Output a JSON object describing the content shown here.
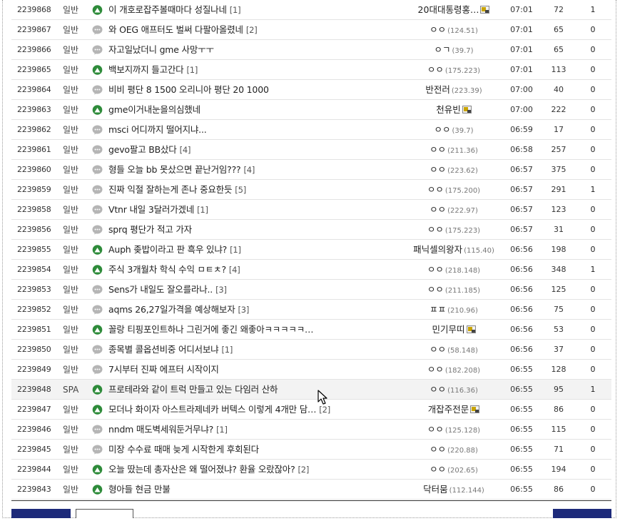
{
  "rows": [
    {
      "num": "2239868",
      "sub": "일반",
      "icon": "image-icon",
      "title": "이 개호로잡주볼때마다 성질나네",
      "comments": "[1]",
      "writer": "20대대통령홍…",
      "ip": "",
      "badge": true,
      "date": "07:01",
      "views": "72",
      "rec": "1"
    },
    {
      "num": "2239867",
      "sub": "일반",
      "icon": "chat-icon",
      "title": "와 OEG 애프터도 벌써 다팔아올렸네",
      "comments": "[2]",
      "writer": "ㅇㅇ",
      "ip": "(124.51)",
      "badge": false,
      "date": "07:01",
      "views": "65",
      "rec": "0"
    },
    {
      "num": "2239866",
      "sub": "일반",
      "icon": "chat-icon",
      "title": "자고일났더니 gme 사망ㅜㅜ",
      "comments": "",
      "writer": "ㅇㄱ",
      "ip": "(39.7)",
      "badge": false,
      "date": "07:01",
      "views": "65",
      "rec": "0"
    },
    {
      "num": "2239865",
      "sub": "일반",
      "icon": "image-icon",
      "title": "백보지까지 들고간다",
      "comments": "[1]",
      "writer": "ㅇㅇ",
      "ip": "(175.223)",
      "badge": false,
      "date": "07:01",
      "views": "113",
      "rec": "0"
    },
    {
      "num": "2239864",
      "sub": "일반",
      "icon": "chat-icon",
      "title": "비비 평단 8 1500 오리니아 평단 20 1000",
      "comments": "",
      "writer": "반전러",
      "ip": "(223.39)",
      "badge": false,
      "date": "07:00",
      "views": "40",
      "rec": "0"
    },
    {
      "num": "2239863",
      "sub": "일반",
      "icon": "image-icon",
      "title": "gme이거내눈을의심했네",
      "comments": "",
      "writer": "천유빈",
      "ip": "",
      "badge": true,
      "date": "07:00",
      "views": "222",
      "rec": "0"
    },
    {
      "num": "2239862",
      "sub": "일반",
      "icon": "chat-icon",
      "title": "msci 어디까지 떨어지냐...",
      "comments": "",
      "writer": "ㅇㅇ",
      "ip": "(39.7)",
      "badge": false,
      "date": "06:59",
      "views": "17",
      "rec": "0"
    },
    {
      "num": "2239861",
      "sub": "일반",
      "icon": "chat-icon",
      "title": "gevo팔고 BB샀다",
      "comments": "[4]",
      "writer": "ㅇㅇ",
      "ip": "(211.36)",
      "badge": false,
      "date": "06:58",
      "views": "257",
      "rec": "0"
    },
    {
      "num": "2239860",
      "sub": "일반",
      "icon": "chat-icon",
      "title": "형들 오늘 bb 못샀으면 끝난거임???",
      "comments": "[4]",
      "writer": "ㅇㅇ",
      "ip": "(223.62)",
      "badge": false,
      "date": "06:57",
      "views": "375",
      "rec": "0"
    },
    {
      "num": "2239859",
      "sub": "일반",
      "icon": "chat-icon",
      "title": "진짜 익절 잘하는게 존나 중요한듯",
      "comments": "[5]",
      "writer": "ㅇㅇ",
      "ip": "(175.200)",
      "badge": false,
      "date": "06:57",
      "views": "291",
      "rec": "1"
    },
    {
      "num": "2239858",
      "sub": "일반",
      "icon": "chat-icon",
      "title": "Vtnr 내일 3달러가겠네",
      "comments": "[1]",
      "writer": "ㅇㅇ",
      "ip": "(222.97)",
      "badge": false,
      "date": "06:57",
      "views": "123",
      "rec": "0"
    },
    {
      "num": "2239856",
      "sub": "일반",
      "icon": "chat-icon",
      "title": "sprq 평단가 적고 가자",
      "comments": "",
      "writer": "ㅇㅇ",
      "ip": "(175.223)",
      "badge": false,
      "date": "06:57",
      "views": "31",
      "rec": "0"
    },
    {
      "num": "2239855",
      "sub": "일반",
      "icon": "image-icon",
      "title": "Auph 좆밥이라고 판 흑우 있냐?",
      "comments": "[1]",
      "writer": "패닉셀의왕자",
      "ip": "(115.40)",
      "badge": false,
      "date": "06:56",
      "views": "198",
      "rec": "0"
    },
    {
      "num": "2239854",
      "sub": "일반",
      "icon": "image-icon",
      "title": "주식 3개월차 학식 수익 ㅁㅌㅊ?",
      "comments": "[4]",
      "writer": "ㅇㅇ",
      "ip": "(218.148)",
      "badge": false,
      "date": "06:56",
      "views": "348",
      "rec": "1"
    },
    {
      "num": "2239853",
      "sub": "일반",
      "icon": "chat-icon",
      "title": "Sens가 내일도 잘오를라나..",
      "comments": "[3]",
      "writer": "ㅇㅇ",
      "ip": "(211.185)",
      "badge": false,
      "date": "06:56",
      "views": "125",
      "rec": "0"
    },
    {
      "num": "2239852",
      "sub": "일반",
      "icon": "chat-icon",
      "title": "aqms 26,27일가격을 예상해보자",
      "comments": "[3]",
      "writer": "ㅍㅍ",
      "ip": "(210.96)",
      "badge": false,
      "date": "06:56",
      "views": "75",
      "rec": "0"
    },
    {
      "num": "2239851",
      "sub": "일반",
      "icon": "image-icon",
      "title": "꼴랑 티핑포인트하나 그린거에 좋긴 왜좋아ㅋㅋㅋㅋㅋ…",
      "comments": "",
      "writer": "민기무띠",
      "ip": "",
      "badge": true,
      "date": "06:56",
      "views": "53",
      "rec": "0"
    },
    {
      "num": "2239850",
      "sub": "일반",
      "icon": "chat-icon",
      "title": "종목별 콜옵션비중 어디서보냐",
      "comments": "[1]",
      "writer": "ㅇㅇ",
      "ip": "(58.148)",
      "badge": false,
      "date": "06:56",
      "views": "37",
      "rec": "0"
    },
    {
      "num": "2239849",
      "sub": "일반",
      "icon": "chat-icon",
      "title": "7시부터 진짜 에프터 시작이지",
      "comments": "",
      "writer": "ㅇㅇ",
      "ip": "(182.208)",
      "badge": false,
      "date": "06:55",
      "views": "128",
      "rec": "0"
    },
    {
      "num": "2239848",
      "sub": "SPA",
      "icon": "image-icon",
      "title": "프로테라와 같이 트럭 만들고 있는 다임러 산하",
      "comments": "",
      "writer": "ㅇㅇ",
      "ip": "(116.36)",
      "badge": false,
      "date": "06:55",
      "views": "95",
      "rec": "1",
      "highlight": true
    },
    {
      "num": "2239847",
      "sub": "일반",
      "icon": "image-icon",
      "title": "모더나 화이자 아스트라제네카 버텍스 이렇게 4개만 담…",
      "comments": "[2]",
      "writer": "개잡주전문",
      "ip": "",
      "badge": true,
      "date": "06:55",
      "views": "86",
      "rec": "0"
    },
    {
      "num": "2239846",
      "sub": "일반",
      "icon": "chat-icon",
      "title": "nndm 매도벽세워둔거무냐?",
      "comments": "[1]",
      "writer": "ㅇㅇ",
      "ip": "(125.128)",
      "badge": false,
      "date": "06:55",
      "views": "115",
      "rec": "0"
    },
    {
      "num": "2239845",
      "sub": "일반",
      "icon": "chat-icon",
      "title": "미장 수수료 때매 늦게 시작한게 후회된다",
      "comments": "",
      "writer": "ㅇㅇ",
      "ip": "(220.88)",
      "badge": false,
      "date": "06:55",
      "views": "71",
      "rec": "0"
    },
    {
      "num": "2239844",
      "sub": "일반",
      "icon": "image-icon",
      "title": "오늘 땄는데 총자산은 왜 떨어졌냐? 환율 오랐잖아?",
      "comments": "[2]",
      "writer": "ㅇㅇ",
      "ip": "(202.65)",
      "badge": false,
      "date": "06:55",
      "views": "194",
      "rec": "0"
    },
    {
      "num": "2239843",
      "sub": "일반",
      "icon": "image-icon",
      "title": "형아들 현금 만불",
      "comments": "",
      "writer": "닥터뭄",
      "ip": "(112.144)",
      "badge": false,
      "date": "06:55",
      "views": "86",
      "rec": "0"
    }
  ],
  "colors": {
    "image_icon": "#2e8b3a",
    "chat_icon": "#b5b5b5",
    "button_navy": "#1d2a7a"
  }
}
